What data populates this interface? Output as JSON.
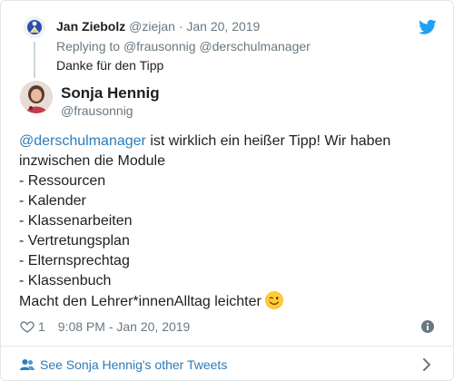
{
  "parent_tweet": {
    "name": "Jan Ziebolz",
    "handle": "@ziejan",
    "separator": "·",
    "date": "Jan 20, 2019",
    "reply_prefix": "Replying to",
    "reply_to_1": "@frausonnig",
    "reply_to_2": "@derschulmanager",
    "text": "Danke für den Tipp"
  },
  "main_tweet": {
    "name": "Sonja Hennig",
    "handle": "@frausonnig",
    "mention": "@derschulmanager",
    "line1_rest": " ist wirklich ein heißer Tipp! Wir haben",
    "line2": "inzwischen die Module",
    "modules": [
      "- Ressourcen",
      "- Kalender",
      "- Klassenarbeiten",
      "- Vertretungsplan",
      "- Elternsprechtag",
      "- Klassenbuch"
    ],
    "closing": "Macht den Lehrer*innenAlltag leichter",
    "emoji": "winking-face",
    "likes": "1",
    "timestamp": "9:08 PM - Jan 20, 2019"
  },
  "footer": {
    "see_more": "See Sonja Hennig's other Tweets"
  },
  "colors": {
    "link": "#2b7bb9",
    "muted": "#697882",
    "twitter_blue": "#1da1f2",
    "border": "#e1e8ed"
  }
}
